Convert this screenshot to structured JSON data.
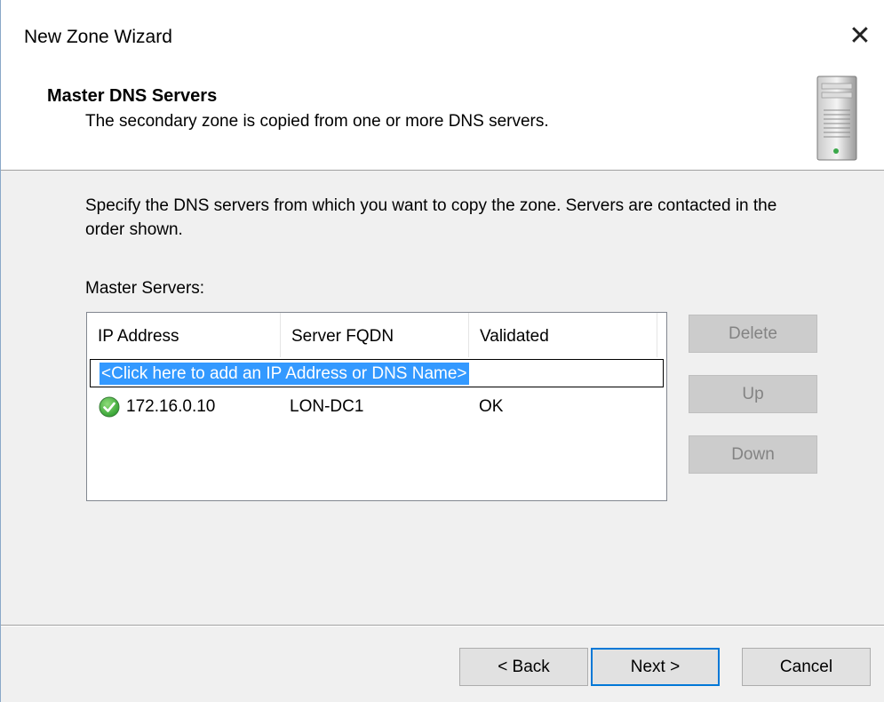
{
  "window": {
    "title": "New Zone Wizard",
    "close_glyph": "✕"
  },
  "header": {
    "title": "Master DNS Servers",
    "subtitle": "The secondary zone is copied from one or more DNS servers.",
    "icon": "server-icon"
  },
  "body": {
    "description": "Specify the DNS servers from which you want to copy the zone.  Servers are contacted in the order shown.",
    "list_label": "Master Servers:"
  },
  "list": {
    "columns": [
      "IP Address",
      "Server FQDN",
      "Validated"
    ],
    "add_placeholder": "<Click here to add an IP Address or DNS Name>",
    "rows": [
      {
        "ip": "172.16.0.10",
        "fqdn": "LON-DC1",
        "validated": "OK",
        "status_icon": "check-icon"
      }
    ]
  },
  "side_buttons": {
    "delete": "Delete",
    "up": "Up",
    "down": "Down"
  },
  "footer": {
    "back": "< Back",
    "next": "Next >",
    "cancel": "Cancel"
  },
  "colors": {
    "selection": "#3399ff",
    "accent": "#0078d7",
    "ok_green": "#2e9e2e"
  }
}
